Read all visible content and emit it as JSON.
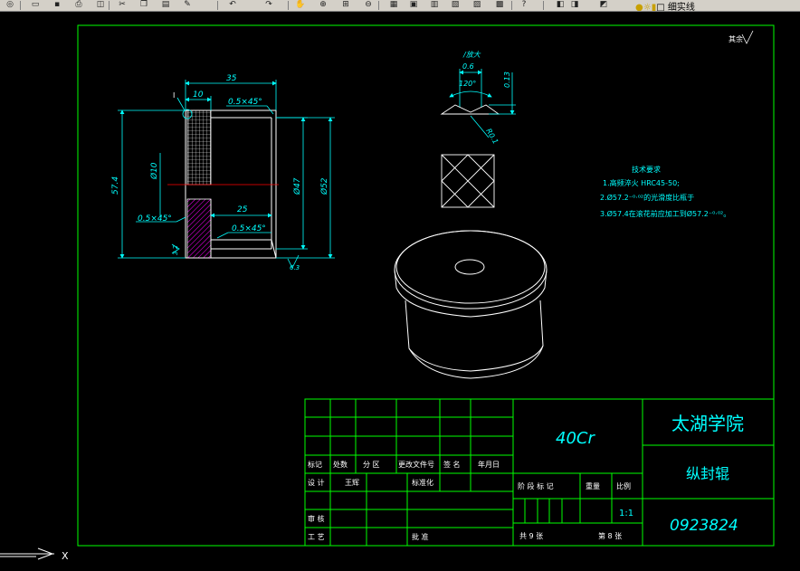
{
  "toolbar": {
    "icons": [
      "globe-icon",
      "open-icon",
      "save-icon",
      "print-icon",
      "preview-icon",
      "cut-icon",
      "copy-icon",
      "paste-icon",
      "match-prop-icon",
      "undo-icon",
      "redo-icon",
      "pan-icon",
      "zoom-realtime-icon",
      "zoom-window-icon",
      "zoom-previous-icon",
      "properties-icon",
      "design-center-icon",
      "tool-palette-icon",
      "sheet-set-icon",
      "markup-icon",
      "calculator-icon",
      "help-icon",
      "layer-manager-icon",
      "layer-state-icon",
      "layer-color-icon"
    ],
    "layer_name": "细实线"
  },
  "drawing": {
    "surface_finish_note": "其余",
    "dims": {
      "d35": "35",
      "d10": "10",
      "chamfer_top": "0.5×45°",
      "dia10": "Ø10",
      "len574": "57.4",
      "chamfer_left": "0.5×45°",
      "d25": "25",
      "chamfer_bottom": "0.5×45°",
      "dia47": "Ø47",
      "dia52": "Ø52",
      "rough_bottom": "6.3",
      "rough_left": "3.2",
      "label_I": "I",
      "max_note": "/放大",
      "d06": "0.6",
      "angle120": "120°",
      "d013": "0.13",
      "r01": "R0.1"
    },
    "tech_req": {
      "title": "技术要求",
      "line1": "1.高频淬火  HRC45-50;",
      "line2": "2.Ø57.2⁻⁰·⁰²的光滑度比瓶于",
      "line3": "3.Ø57.4在滚花前应加工到Ø57.2⁻⁰·⁰²。"
    }
  },
  "title_block": {
    "school": "太湖学院",
    "material": "40Cr",
    "part_name": "纵封辊",
    "drawing_no": "0923824",
    "scale": "1:1",
    "labels": {
      "mark": "标记",
      "count": "处数",
      "zone": "分 区",
      "change_doc": "更改文件号",
      "signature": "签 名",
      "date": "年月日",
      "design": "设 计",
      "designer": "王辉",
      "standardize": "标准化",
      "stage_mark": "阶 段 标 记",
      "weight": "重量",
      "ratio": "比例",
      "review": "审 核",
      "process": "工 艺",
      "approve": "批 准",
      "total_sheets": "共 9 张",
      "sheet_no": "第 8 张"
    }
  },
  "colors": {
    "frame": "#00ff00",
    "lines": "#ffffff",
    "dims": "#00ffff",
    "center": "#ff0000",
    "hatch": "#ff00ff",
    "text_dim": "#00ffff",
    "title": "#00ffff"
  }
}
